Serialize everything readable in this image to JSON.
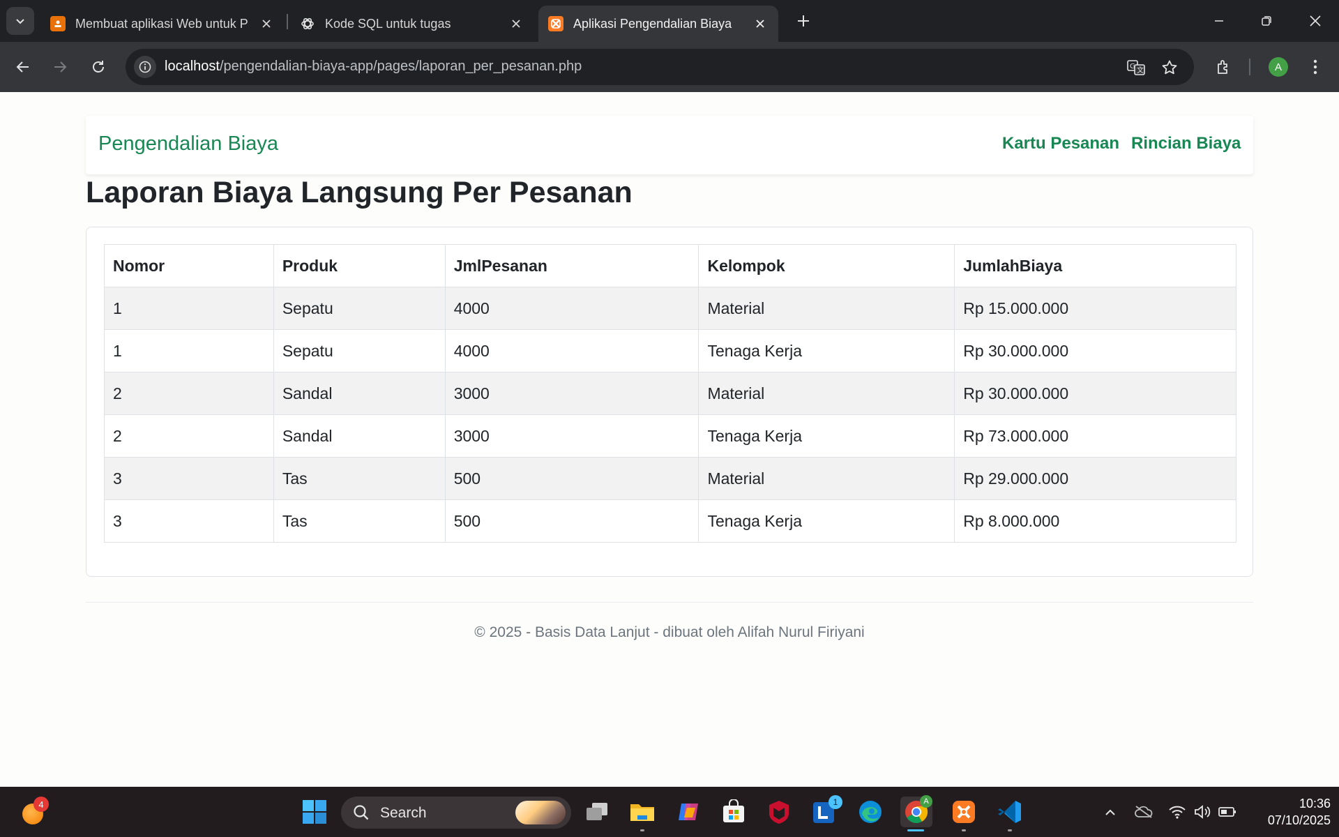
{
  "browser": {
    "tabs": [
      {
        "title": "Membuat aplikasi Web untuk P",
        "favicon": "slides-icon",
        "favicon_color": "#e8710a",
        "active": false
      },
      {
        "title": "Kode SQL untuk tugas",
        "favicon": "openai-icon",
        "favicon_color": "#ffffff",
        "active": false
      },
      {
        "title": "Aplikasi Pengendalian Biaya",
        "favicon": "xampp-icon",
        "favicon_color": "#fb7a24",
        "active": true
      }
    ],
    "address": {
      "host": "localhost",
      "path": "/pengendalian-biaya-app/pages/laporan_per_pesanan.php"
    },
    "profile_initial": "A",
    "profile_color": "#43a047"
  },
  "page": {
    "brand": "Pengendalian Biaya",
    "nav_links": [
      "Kartu Pesanan",
      "Rincian Biaya"
    ],
    "accent_color": "#198754",
    "title": "Laporan Biaya Langsung Per Pesanan",
    "table": {
      "columns": [
        "Nomor",
        "Produk",
        "JmlPesanan",
        "Kelompok",
        "JumlahBiaya"
      ],
      "rows": [
        [
          "1",
          "Sepatu",
          "4000",
          "Material",
          "Rp 15.000.000"
        ],
        [
          "1",
          "Sepatu",
          "4000",
          "Tenaga Kerja",
          "Rp 30.000.000"
        ],
        [
          "2",
          "Sandal",
          "3000",
          "Material",
          "Rp 30.000.000"
        ],
        [
          "2",
          "Sandal",
          "3000",
          "Tenaga Kerja",
          "Rp 73.000.000"
        ],
        [
          "3",
          "Tas",
          "500",
          "Material",
          "Rp 29.000.000"
        ],
        [
          "3",
          "Tas",
          "500",
          "Tenaga Kerja",
          "Rp 8.000.000"
        ]
      ]
    },
    "footer": "© 2025 - Basis Data Lanjut - dibuat oleh Alifah Nurul Firiyani"
  },
  "taskbar": {
    "weather_badge": "4",
    "search_label": "Search",
    "notification_badge_l": "1",
    "chrome_profile_badge": "A",
    "time": "10:36",
    "date": "07/10/2025"
  }
}
